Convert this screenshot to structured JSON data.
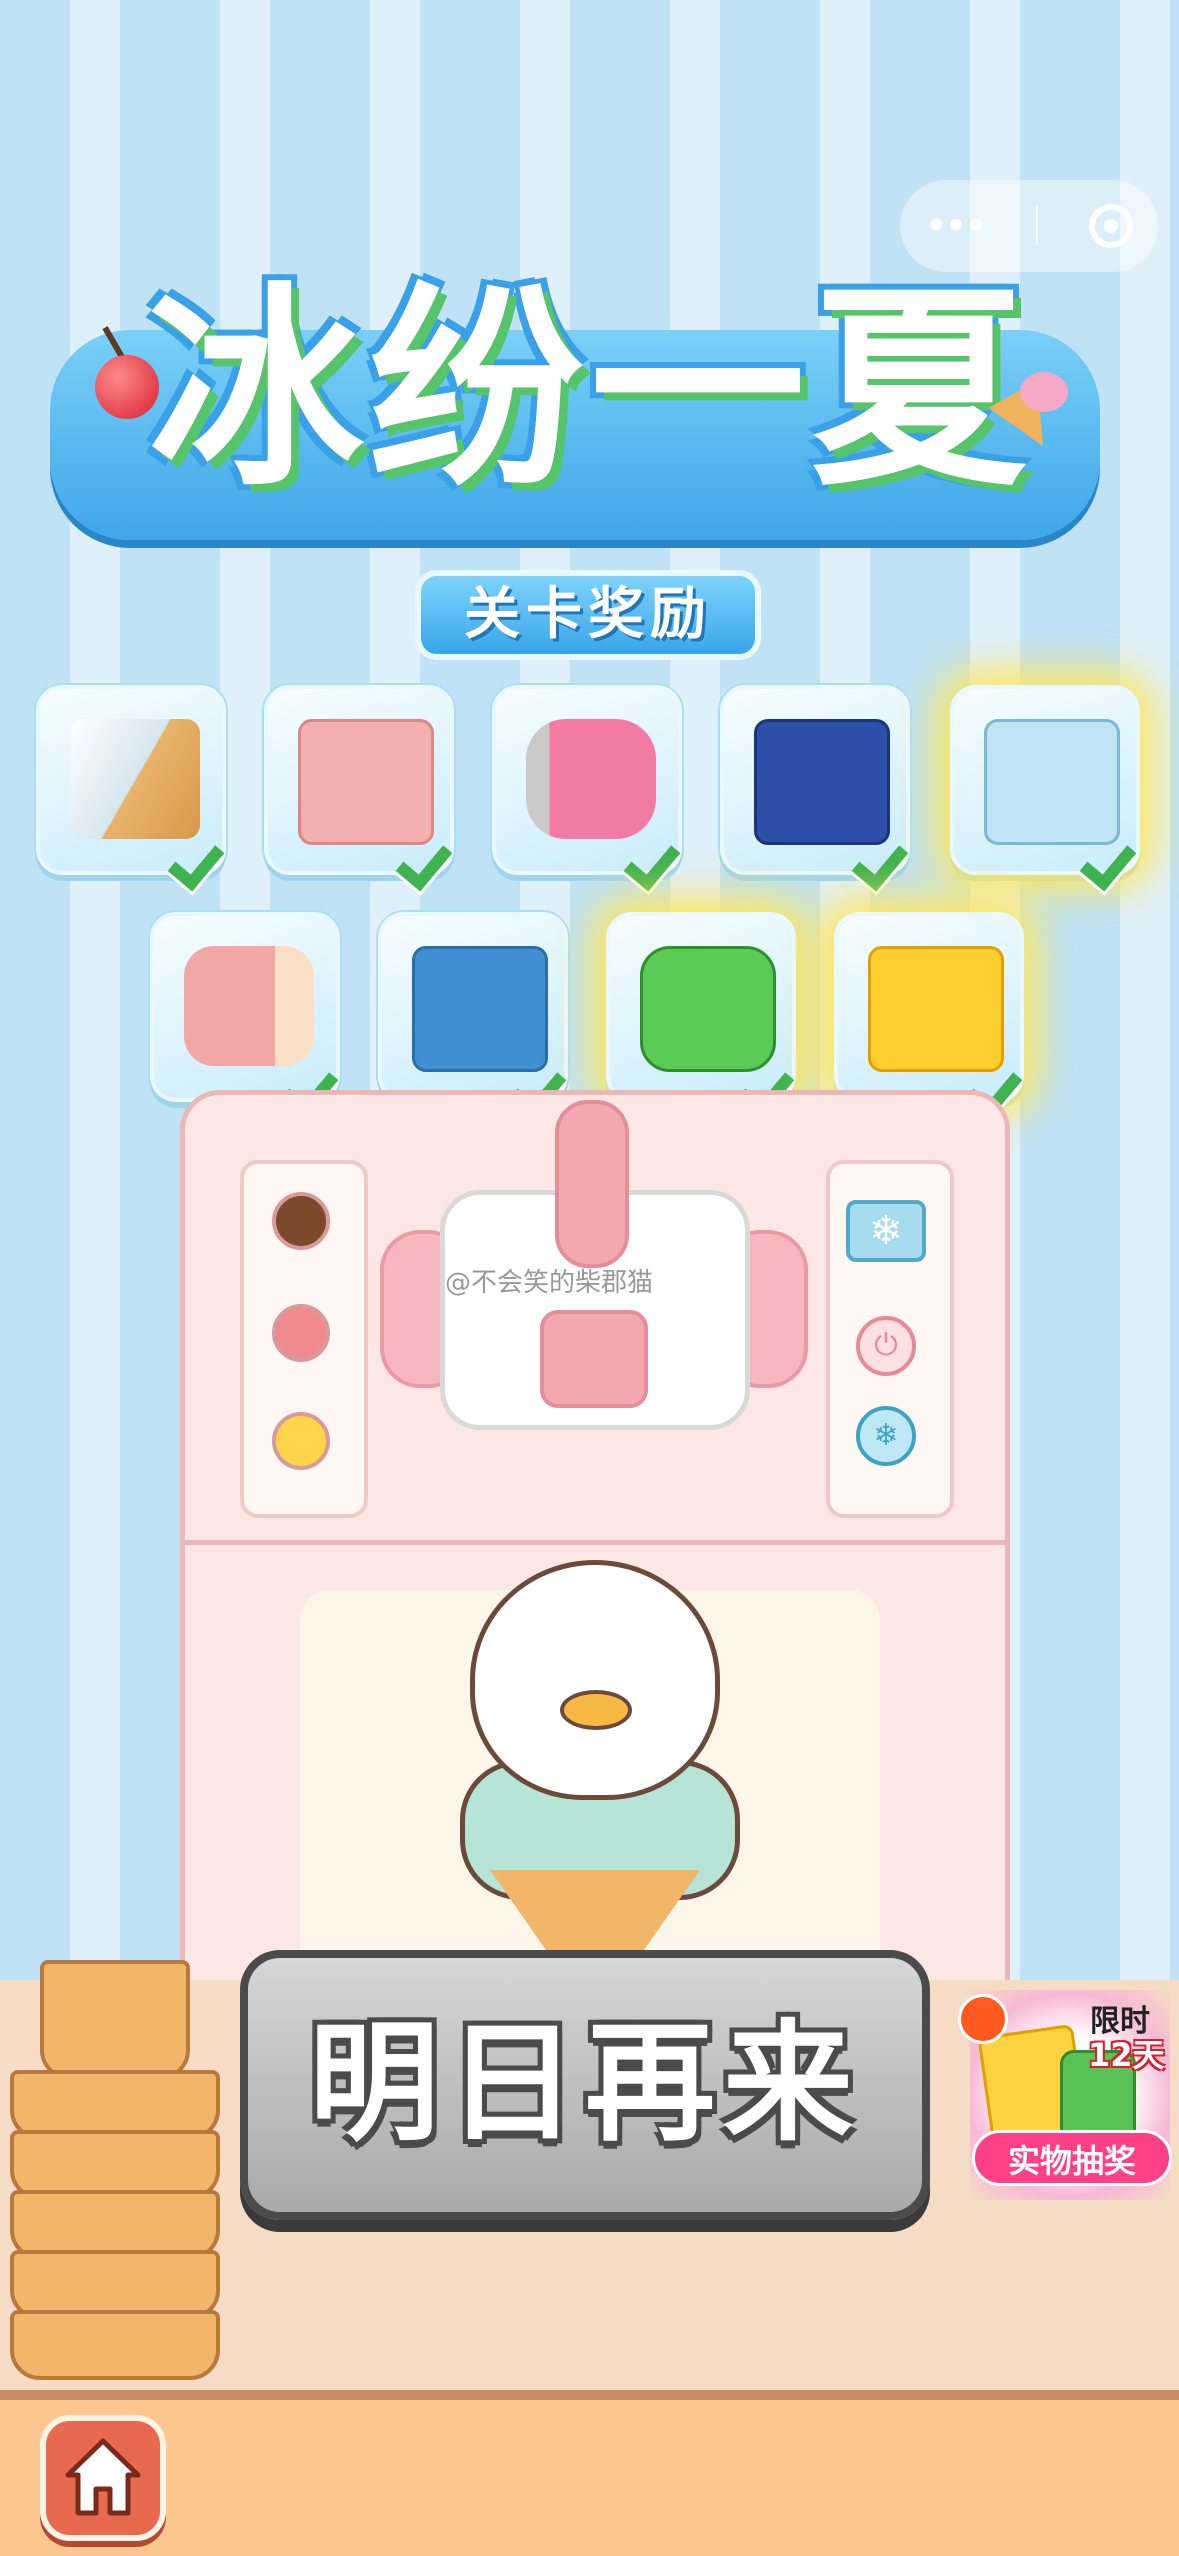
{
  "header": {
    "title": "冰纷一夏",
    "subtitle": "关卡奖励"
  },
  "rewards": [
    {
      "name": "ice-cream-cone",
      "color": "#eef6fb",
      "claimed": true
    },
    {
      "name": "pink-cake",
      "color": "#f4b0ae",
      "claimed": true
    },
    {
      "name": "pink-can",
      "color": "#f27ba3",
      "claimed": true
    },
    {
      "name": "blue-ice-cream-box",
      "color": "#2c4fa8",
      "claimed": true
    },
    {
      "name": "mini-fridge",
      "color": "#bfe4f6",
      "claimed": true
    },
    {
      "name": "popsicle-roll",
      "color": "#f3a6a6",
      "claimed": true
    },
    {
      "name": "rice-cake-pack",
      "color": "#3f8fd2",
      "claimed": true
    },
    {
      "name": "green-duck-bag",
      "color": "#5acb55",
      "claimed": true
    },
    {
      "name": "duck-snack-bag",
      "color": "#ffcf2f",
      "claimed": true
    }
  ],
  "machine": {
    "watermark": "@不会笑的柴郡猫",
    "knob_colors": [
      "#7a4a2b",
      "#f08a8f",
      "#ffd64a"
    ]
  },
  "action_button": {
    "label": "明日再来"
  },
  "lottery": {
    "badge_line1": "限时",
    "badge_line2": "12天",
    "label": "实物抽奖"
  },
  "icons": {
    "capsule_menu": "more-dots-icon",
    "capsule_close": "target-icon",
    "home": "home-icon",
    "check": "check-icon"
  },
  "colors": {
    "check_green": "#3fb34f",
    "button_gray": "#a9a9a9",
    "lottery_pink": "#ff3f86"
  }
}
